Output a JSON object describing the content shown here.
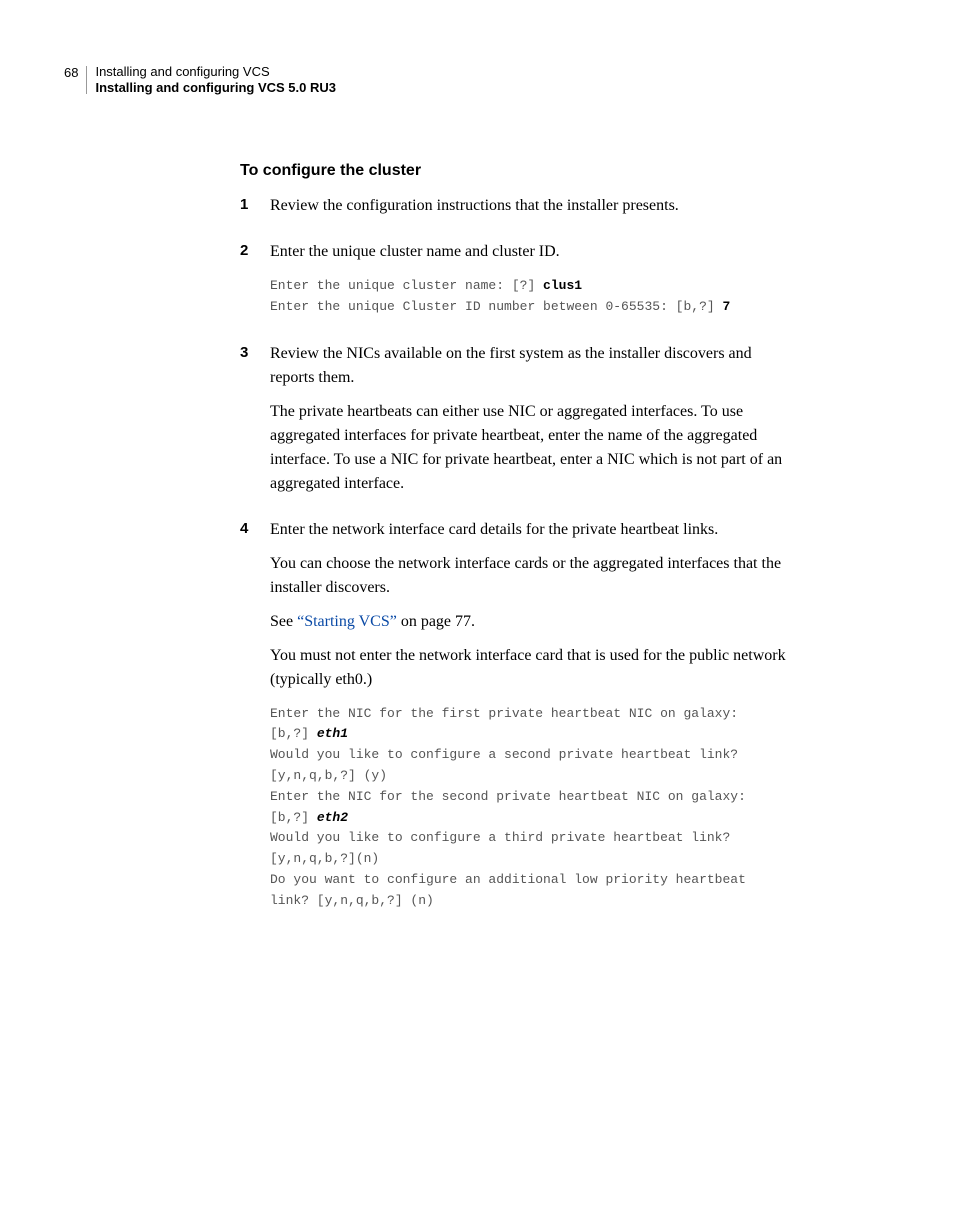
{
  "header": {
    "page_number": "68",
    "line1": "Installing and configuring VCS",
    "line2": "Installing and configuring VCS 5.0 RU3"
  },
  "section_title": "To configure the cluster",
  "steps": {
    "s1": {
      "num": "1",
      "p1": "Review the configuration instructions that the installer presents."
    },
    "s2": {
      "num": "2",
      "p1": "Enter the unique cluster name and cluster ID.",
      "code1_a": "Enter the unique cluster name: [?] ",
      "code1_b": "clus1",
      "code1_c": "\nEnter the unique Cluster ID number between 0-65535: [b,?] ",
      "code1_d": "7"
    },
    "s3": {
      "num": "3",
      "p1": "Review the NICs available on the first system as the installer discovers and reports them.",
      "p2": "The private heartbeats can either use NIC or aggregated interfaces. To use aggregated interfaces for private heartbeat, enter the name of the aggregated interface. To use a NIC for private heartbeat, enter a NIC which is not part of an aggregated interface."
    },
    "s4": {
      "num": "4",
      "p1": "Enter the network interface card details for the private heartbeat links.",
      "p2": "You can choose the network interface cards or the aggregated interfaces that the installer discovers.",
      "p3_a": "See ",
      "p3_link": "“Starting VCS”",
      "p3_b": " on page 77.",
      "p4": "You must not enter the network interface card that is used for the public network (typically eth0.)",
      "code_a": "Enter the NIC for the first private heartbeat NIC on galaxy:\n[b,?] ",
      "code_eth1": "eth1",
      "code_b": "\nWould you like to configure a second private heartbeat link?\n[y,n,q,b,?] (y)\nEnter the NIC for the second private heartbeat NIC on galaxy:\n[b,?] ",
      "code_eth2": "eth2",
      "code_c": "\nWould you like to configure a third private heartbeat link?\n[y,n,q,b,?](n)\nDo you want to configure an additional low priority heartbeat\nlink? [y,n,q,b,?] (n)"
    }
  }
}
